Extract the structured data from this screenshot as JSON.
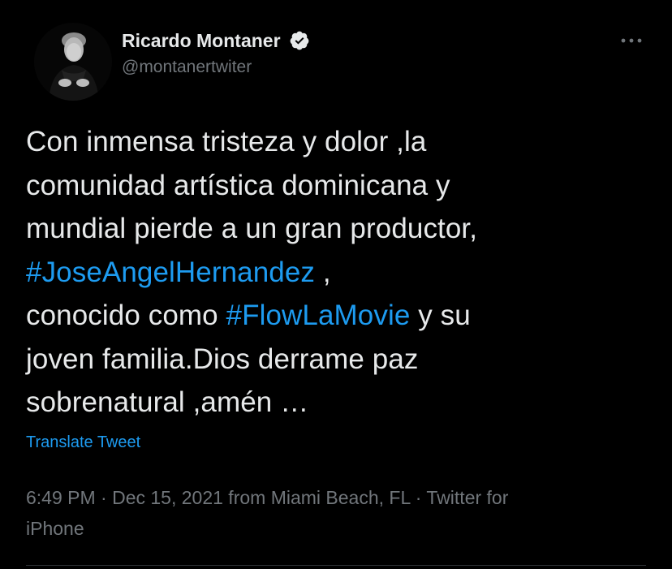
{
  "user": {
    "display_name": "Ricardo Montaner",
    "handle": "@montanertwiter",
    "verified_icon": "verified-badge-icon",
    "avatar": "profile-photo"
  },
  "more_icon": "more-horizontal-icon",
  "tweet": {
    "line1": "Con inmensa tristeza y dolor ,la",
    "line2": "comunidad artística dominicana y",
    "line3": "mundial pierde a un gran productor,",
    "hashtag1": "#JoseAngelHernandez",
    "line4_suffix": " ,",
    "line5_prefix": "conocido como ",
    "hashtag2": "#FlowLaMovie",
    "line5_suffix": " y su",
    "line6": "joven familia.Dios derrame paz",
    "line7": "sobrenatural ,amén …"
  },
  "translate_label": "Translate Tweet",
  "meta": {
    "line1": "6:49 PM · Dec 15, 2021 from Miami Beach, FL · Twitter for",
    "line2": "iPhone"
  },
  "colors": {
    "background": "#000000",
    "text": "#e7e9ea",
    "secondary": "#71767b",
    "accent": "#1d9bf0"
  }
}
